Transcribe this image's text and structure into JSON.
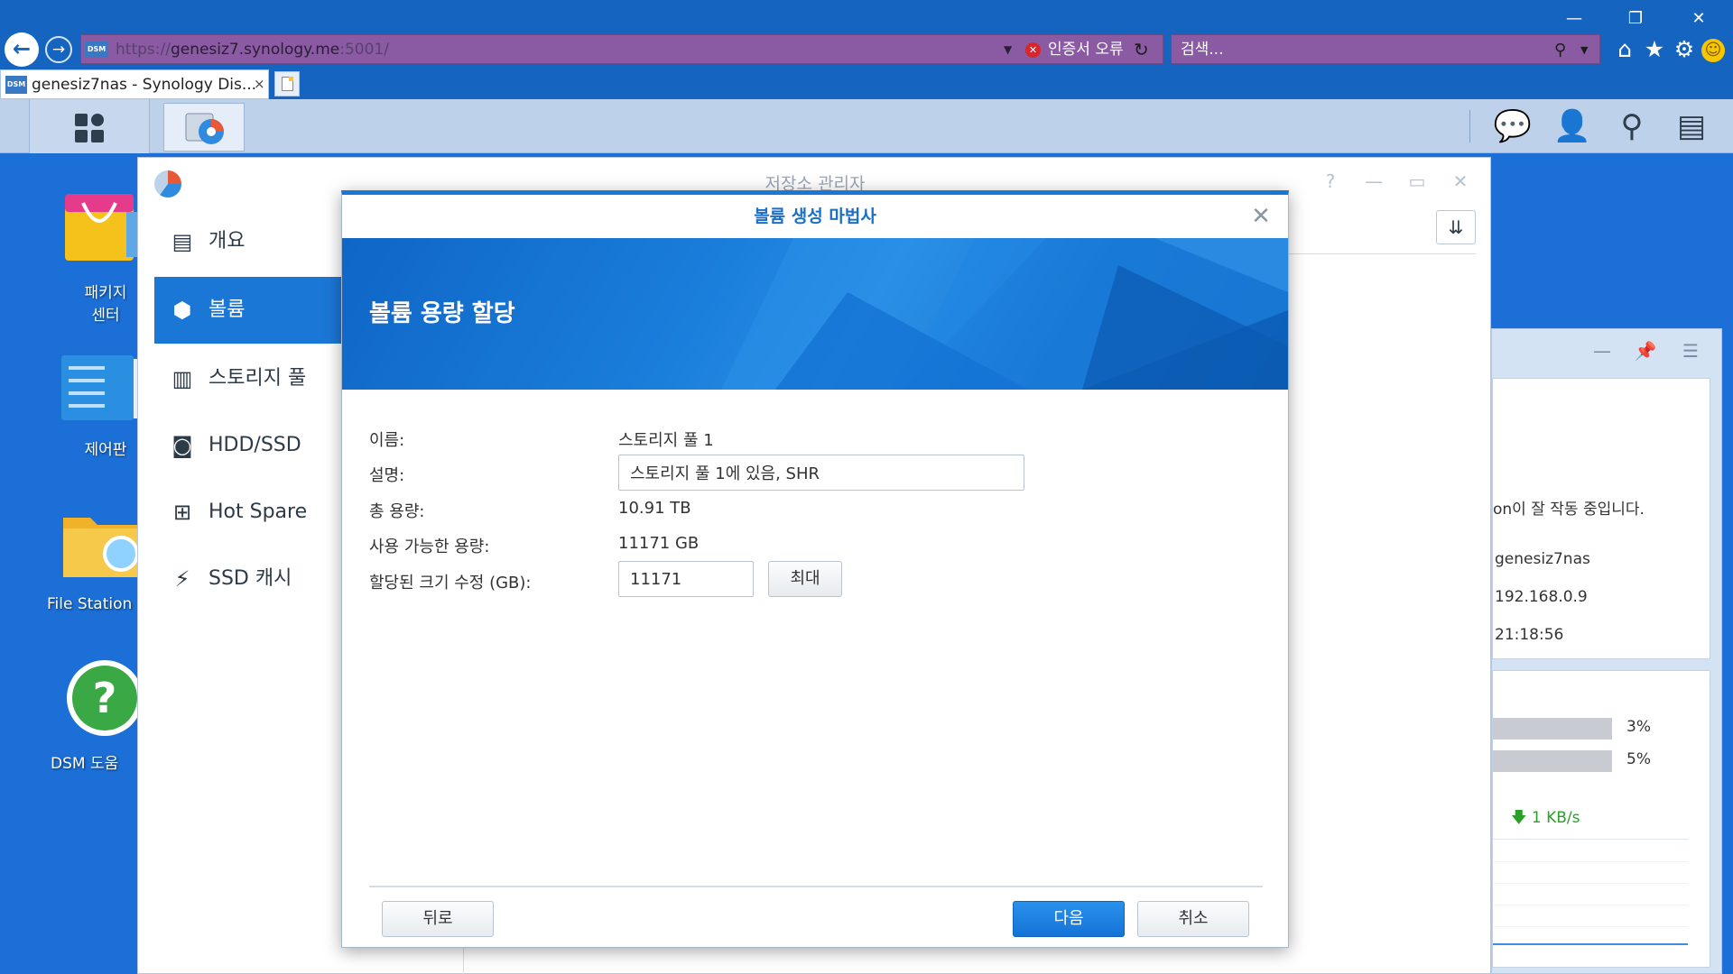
{
  "browser": {
    "address": {
      "scheme": "https://",
      "host": "genesiz7.synology.me",
      "port": ":5001/",
      "favicon_text": "DSM"
    },
    "cert_error": "인증서 오류",
    "search_placeholder": "검색...",
    "tab": {
      "title": "genesiz7nas - Synology Dis...",
      "close": "×",
      "favicon_text": "DSM"
    }
  },
  "desktop": {
    "icons": [
      {
        "label": "패키지\n센터"
      },
      {
        "label": "제어판"
      },
      {
        "label": "File Station"
      },
      {
        "label": "DSM 도움"
      }
    ]
  },
  "storage_manager": {
    "title": "저장소 관리자",
    "sidebar": [
      {
        "label": "개요",
        "icon": "overview-icon"
      },
      {
        "label": "볼륨",
        "icon": "volume-icon",
        "active": true
      },
      {
        "label": "스토리지 풀",
        "icon": "storage-pool-icon"
      },
      {
        "label": "HDD/SSD",
        "icon": "hdd-icon"
      },
      {
        "label": "Hot Spare",
        "icon": "hot-spare-icon"
      },
      {
        "label": "SSD 캐시",
        "icon": "ssd-cache-icon"
      }
    ]
  },
  "widget": {
    "status_text": "on이 잘 작동 중입니다.",
    "server_name": "genesiz7nas",
    "ip": "192.168.0.9",
    "time": "21:18:56",
    "cpu_pct": "3%",
    "ram_pct": "5%",
    "cpu_fraction": 0.03,
    "ram_fraction": 0.05,
    "net": "1 KB/s"
  },
  "wizard": {
    "title": "볼륨 생성 마법사",
    "heading": "볼륨 용량 할당",
    "fields": {
      "name_label": "이름:",
      "name_value": "스토리지 풀 1",
      "desc_label": "설명:",
      "desc_value": "스토리지 풀 1에 있음, SHR",
      "total_label": "총 용량:",
      "total_value": "10.91 TB",
      "available_label": "사용 가능한 용량:",
      "available_value": "11171 GB",
      "alloc_label": "할당된 크기 수정 (GB):",
      "alloc_value": "11171",
      "max_button": "최대"
    },
    "buttons": {
      "back": "뒤로",
      "next": "다음",
      "cancel": "취소"
    }
  }
}
